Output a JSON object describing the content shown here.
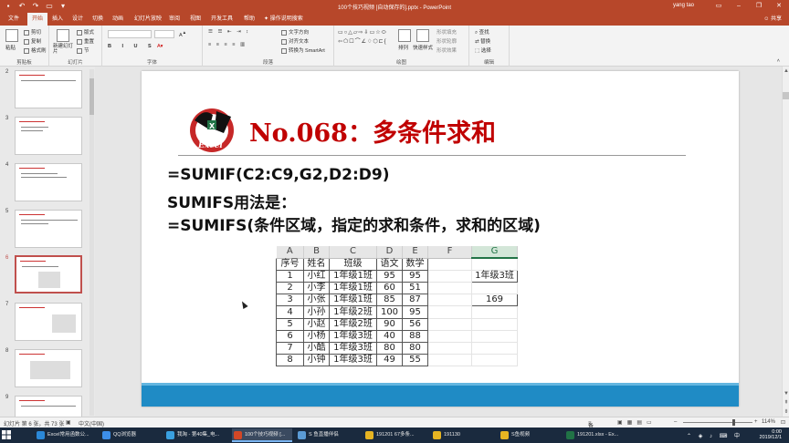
{
  "window": {
    "title": "100个技巧视频 [自动保存的].pptx - PowerPoint",
    "user": "yang tao"
  },
  "tabs": [
    {
      "label": "文件"
    },
    {
      "label": "开始"
    },
    {
      "label": "插入"
    },
    {
      "label": "设计"
    },
    {
      "label": "切换"
    },
    {
      "label": "动画"
    },
    {
      "label": "幻灯片放映"
    },
    {
      "label": "审阅"
    },
    {
      "label": "视图"
    },
    {
      "label": "开发工具"
    },
    {
      "label": "帮助"
    },
    {
      "label": "操作说明搜索"
    }
  ],
  "share_label": "共享",
  "ribbon": {
    "clipboard": {
      "paste": "粘贴",
      "cut": "剪切",
      "copy": "复制",
      "format_painter": "格式刷",
      "label": "剪贴板"
    },
    "slides": {
      "new_slide": "新建幻灯片",
      "layout": "版式",
      "reset": "重置",
      "section": "节",
      "label": "幻灯片"
    },
    "font": {
      "label": "字体"
    },
    "paragraph": {
      "text_direction": "文字方向",
      "align_text": "对齐文本",
      "smartart": "转换为 SmartArt",
      "label": "段落"
    },
    "drawing": {
      "arrange": "排列",
      "quick_styles": "快速样式",
      "shape_fill": "形状填充",
      "shape_outline": "形状轮廓",
      "shape_effects": "形状效果",
      "label": "绘图"
    },
    "editing": {
      "find": "查找",
      "replace": "替换",
      "select": "选择",
      "label": "编辑"
    }
  },
  "thumbnails": [
    {
      "num": "2",
      "active": false
    },
    {
      "num": "3",
      "active": false
    },
    {
      "num": "4",
      "active": false
    },
    {
      "num": "5",
      "active": false
    },
    {
      "num": "6",
      "active": true
    },
    {
      "num": "7",
      "active": false
    },
    {
      "num": "8",
      "active": false
    },
    {
      "num": "9",
      "active": false
    }
  ],
  "slide": {
    "title": "No.068：多条件求和",
    "lines": [
      "=SUMIF(C2:C9,G2,D2:D9)",
      "SUMIFS用法是：",
      "=SUMIFS(条件区域，指定的求和条件，求和的区域)"
    ],
    "logo_text": "Excel",
    "colors": {
      "title": "#c00000",
      "footer_bar": "#1f8bc5"
    }
  },
  "excel_table": {
    "col_headers": [
      "A",
      "B",
      "C",
      "D",
      "E",
      "F",
      "G"
    ],
    "header_row": [
      "序号",
      "姓名",
      "班级",
      "语文",
      "数学"
    ],
    "rows": [
      [
        "1",
        "小红",
        "1年级1班",
        "95",
        "95"
      ],
      [
        "2",
        "小李",
        "1年级1班",
        "60",
        "51"
      ],
      [
        "3",
        "小张",
        "1年级1班",
        "85",
        "87"
      ],
      [
        "4",
        "小孙",
        "1年级2班",
        "100",
        "95"
      ],
      [
        "5",
        "小赵",
        "1年级2班",
        "90",
        "56"
      ],
      [
        "6",
        "小杨",
        "1年级3班",
        "40",
        "88"
      ],
      [
        "7",
        "小酷",
        "1年级3班",
        "80",
        "80"
      ],
      [
        "8",
        "小钟",
        "1年级3班",
        "49",
        "55"
      ]
    ],
    "criteria": "1年级3班",
    "result": "169"
  },
  "statusbar": {
    "slide_info": "幻灯片 第 6 张，共 73 张",
    "language": "中文(中国)",
    "notes": "备注",
    "zoom": "114%"
  },
  "taskbar": {
    "items": [
      {
        "label": "Excel常用函数公...",
        "color": "#2b88d8",
        "active": false
      },
      {
        "label": "QQ浏览器",
        "color": "#3d8ee8",
        "active": false
      },
      {
        "label": "我淘 - 第40集_电...",
        "color": "#3aa0e0",
        "active": false
      },
      {
        "label": "100个技巧视频 [...",
        "color": "#d24726",
        "active": true
      },
      {
        "label": "S 鱼直播伴侣",
        "color": "#5b9bd5",
        "active": false
      },
      {
        "label": "191201 67多条...",
        "color": "#e6b422",
        "active": false
      },
      {
        "label": "191130",
        "color": "#e6b422",
        "active": false
      },
      {
        "label": "S鱼视频",
        "color": "#e6b422",
        "active": false
      },
      {
        "label": "191201.xlsx - Ex...",
        "color": "#217346",
        "active": false
      }
    ],
    "time": "0:00",
    "date": "2019/12/1"
  }
}
